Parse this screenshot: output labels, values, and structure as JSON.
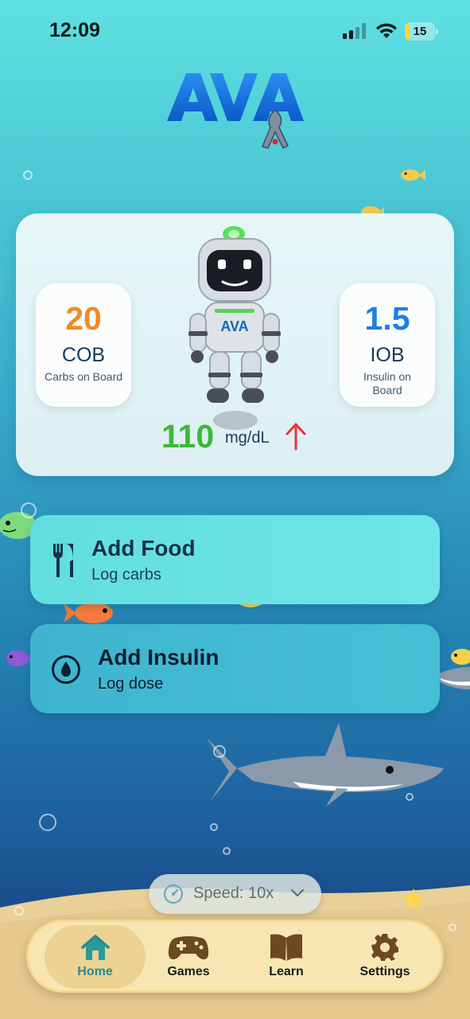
{
  "status_bar": {
    "time": "12:09",
    "battery": "15"
  },
  "app": {
    "logo_text": "AVA"
  },
  "dashboard": {
    "cob": {
      "value": "20",
      "label": "COB",
      "desc": "Carbs on Board",
      "color": "#f08a2c"
    },
    "iob": {
      "value": "1.5",
      "label": "IOB",
      "desc": "Insulin on Board",
      "color": "#1f7fe0"
    },
    "robot_badge": "AVA",
    "glucose": {
      "value": "110",
      "unit": "mg/dL",
      "trend": "up",
      "trend_color": "#e8323c"
    }
  },
  "actions": {
    "food": {
      "title": "Add Food",
      "subtitle": "Log carbs",
      "icon": "fork-knife-icon"
    },
    "insulin": {
      "title": "Add Insulin",
      "subtitle": "Log dose",
      "icon": "drop-icon"
    }
  },
  "speed": {
    "label": "Speed: 10x"
  },
  "tabs": [
    {
      "label": "Home",
      "icon": "home-icon",
      "active": true
    },
    {
      "label": "Games",
      "icon": "gamepad-icon",
      "active": false
    },
    {
      "label": "Learn",
      "icon": "book-icon",
      "active": false
    },
    {
      "label": "Settings",
      "icon": "gear-icon",
      "active": false
    }
  ]
}
